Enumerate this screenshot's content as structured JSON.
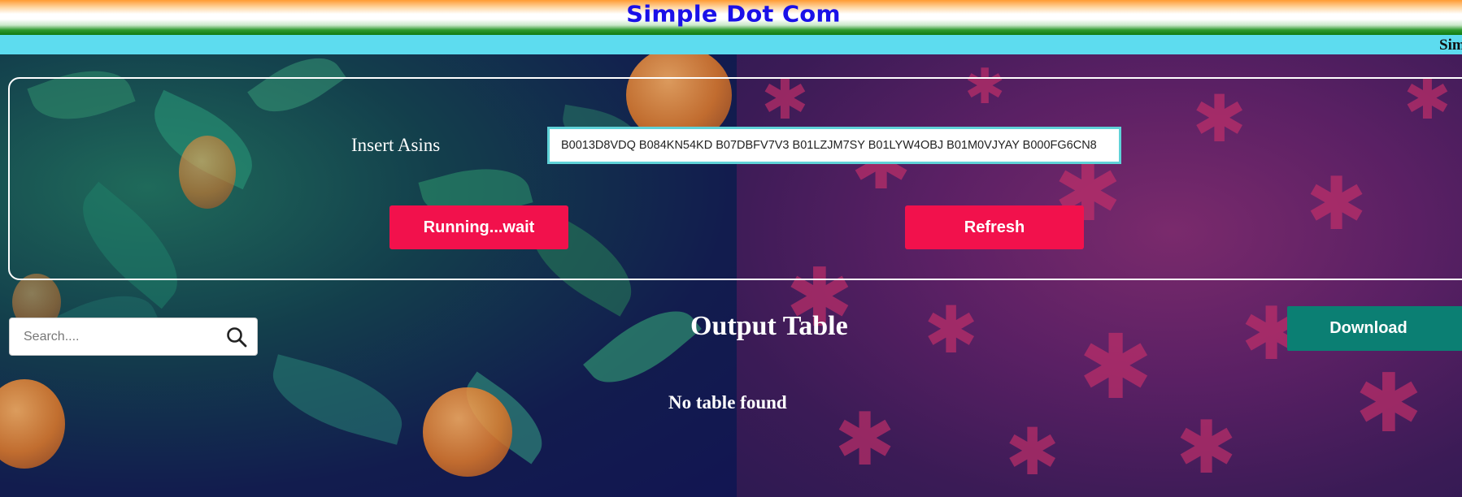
{
  "header": {
    "title": "Simple Dot Com"
  },
  "ticker": {
    "text": "Simple Dot Com"
  },
  "form": {
    "asin_label": "Insert Asins",
    "asin_value": "B0013D8VDQ B084KN54KD B07DBFV7V3 B01LZJM7SY B01LYW4OBJ B01M0VJYAY B000FG6CN8",
    "run_button": "Running...wait",
    "refresh_button": "Refresh"
  },
  "search": {
    "placeholder": "Search...."
  },
  "output": {
    "title": "Output Table",
    "download_button": "Download",
    "empty_message": "No table found"
  },
  "icons": {
    "search": "search-icon"
  },
  "colors": {
    "title": "#1a10e8",
    "ticker_bg": "#5ddcef",
    "primary_button": "#f2114c",
    "download_button": "#0b7f73",
    "input_border": "#5fd2d8"
  }
}
